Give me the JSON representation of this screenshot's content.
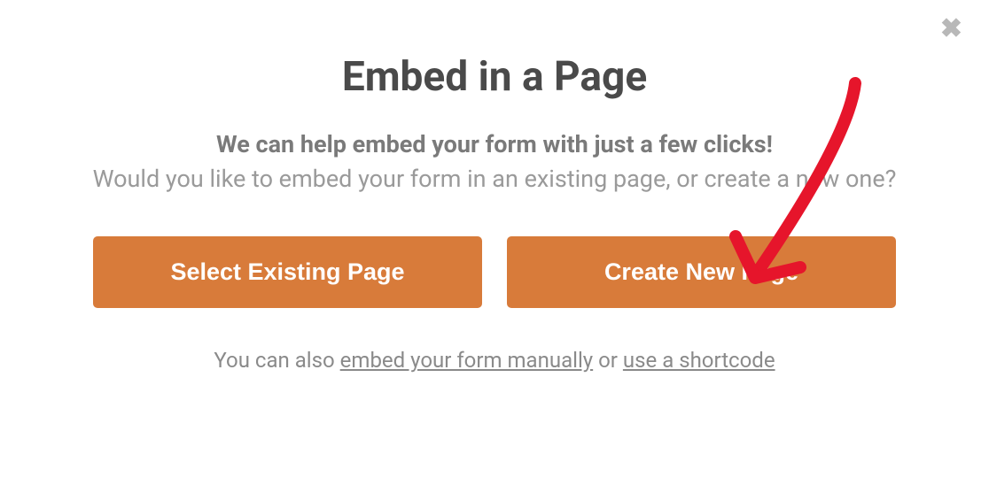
{
  "modal": {
    "title": "Embed in a Page",
    "description_bold": "We can help embed your form with just a few clicks!",
    "description_regular": "Would you like to embed your form in an existing page, or create a new one?"
  },
  "buttons": {
    "select_existing": "Select Existing Page",
    "create_new": "Create New Page"
  },
  "footer": {
    "prefix": "You can also ",
    "link_manual": "embed your form manually",
    "middle": " or ",
    "link_shortcode": "use a shortcode"
  }
}
